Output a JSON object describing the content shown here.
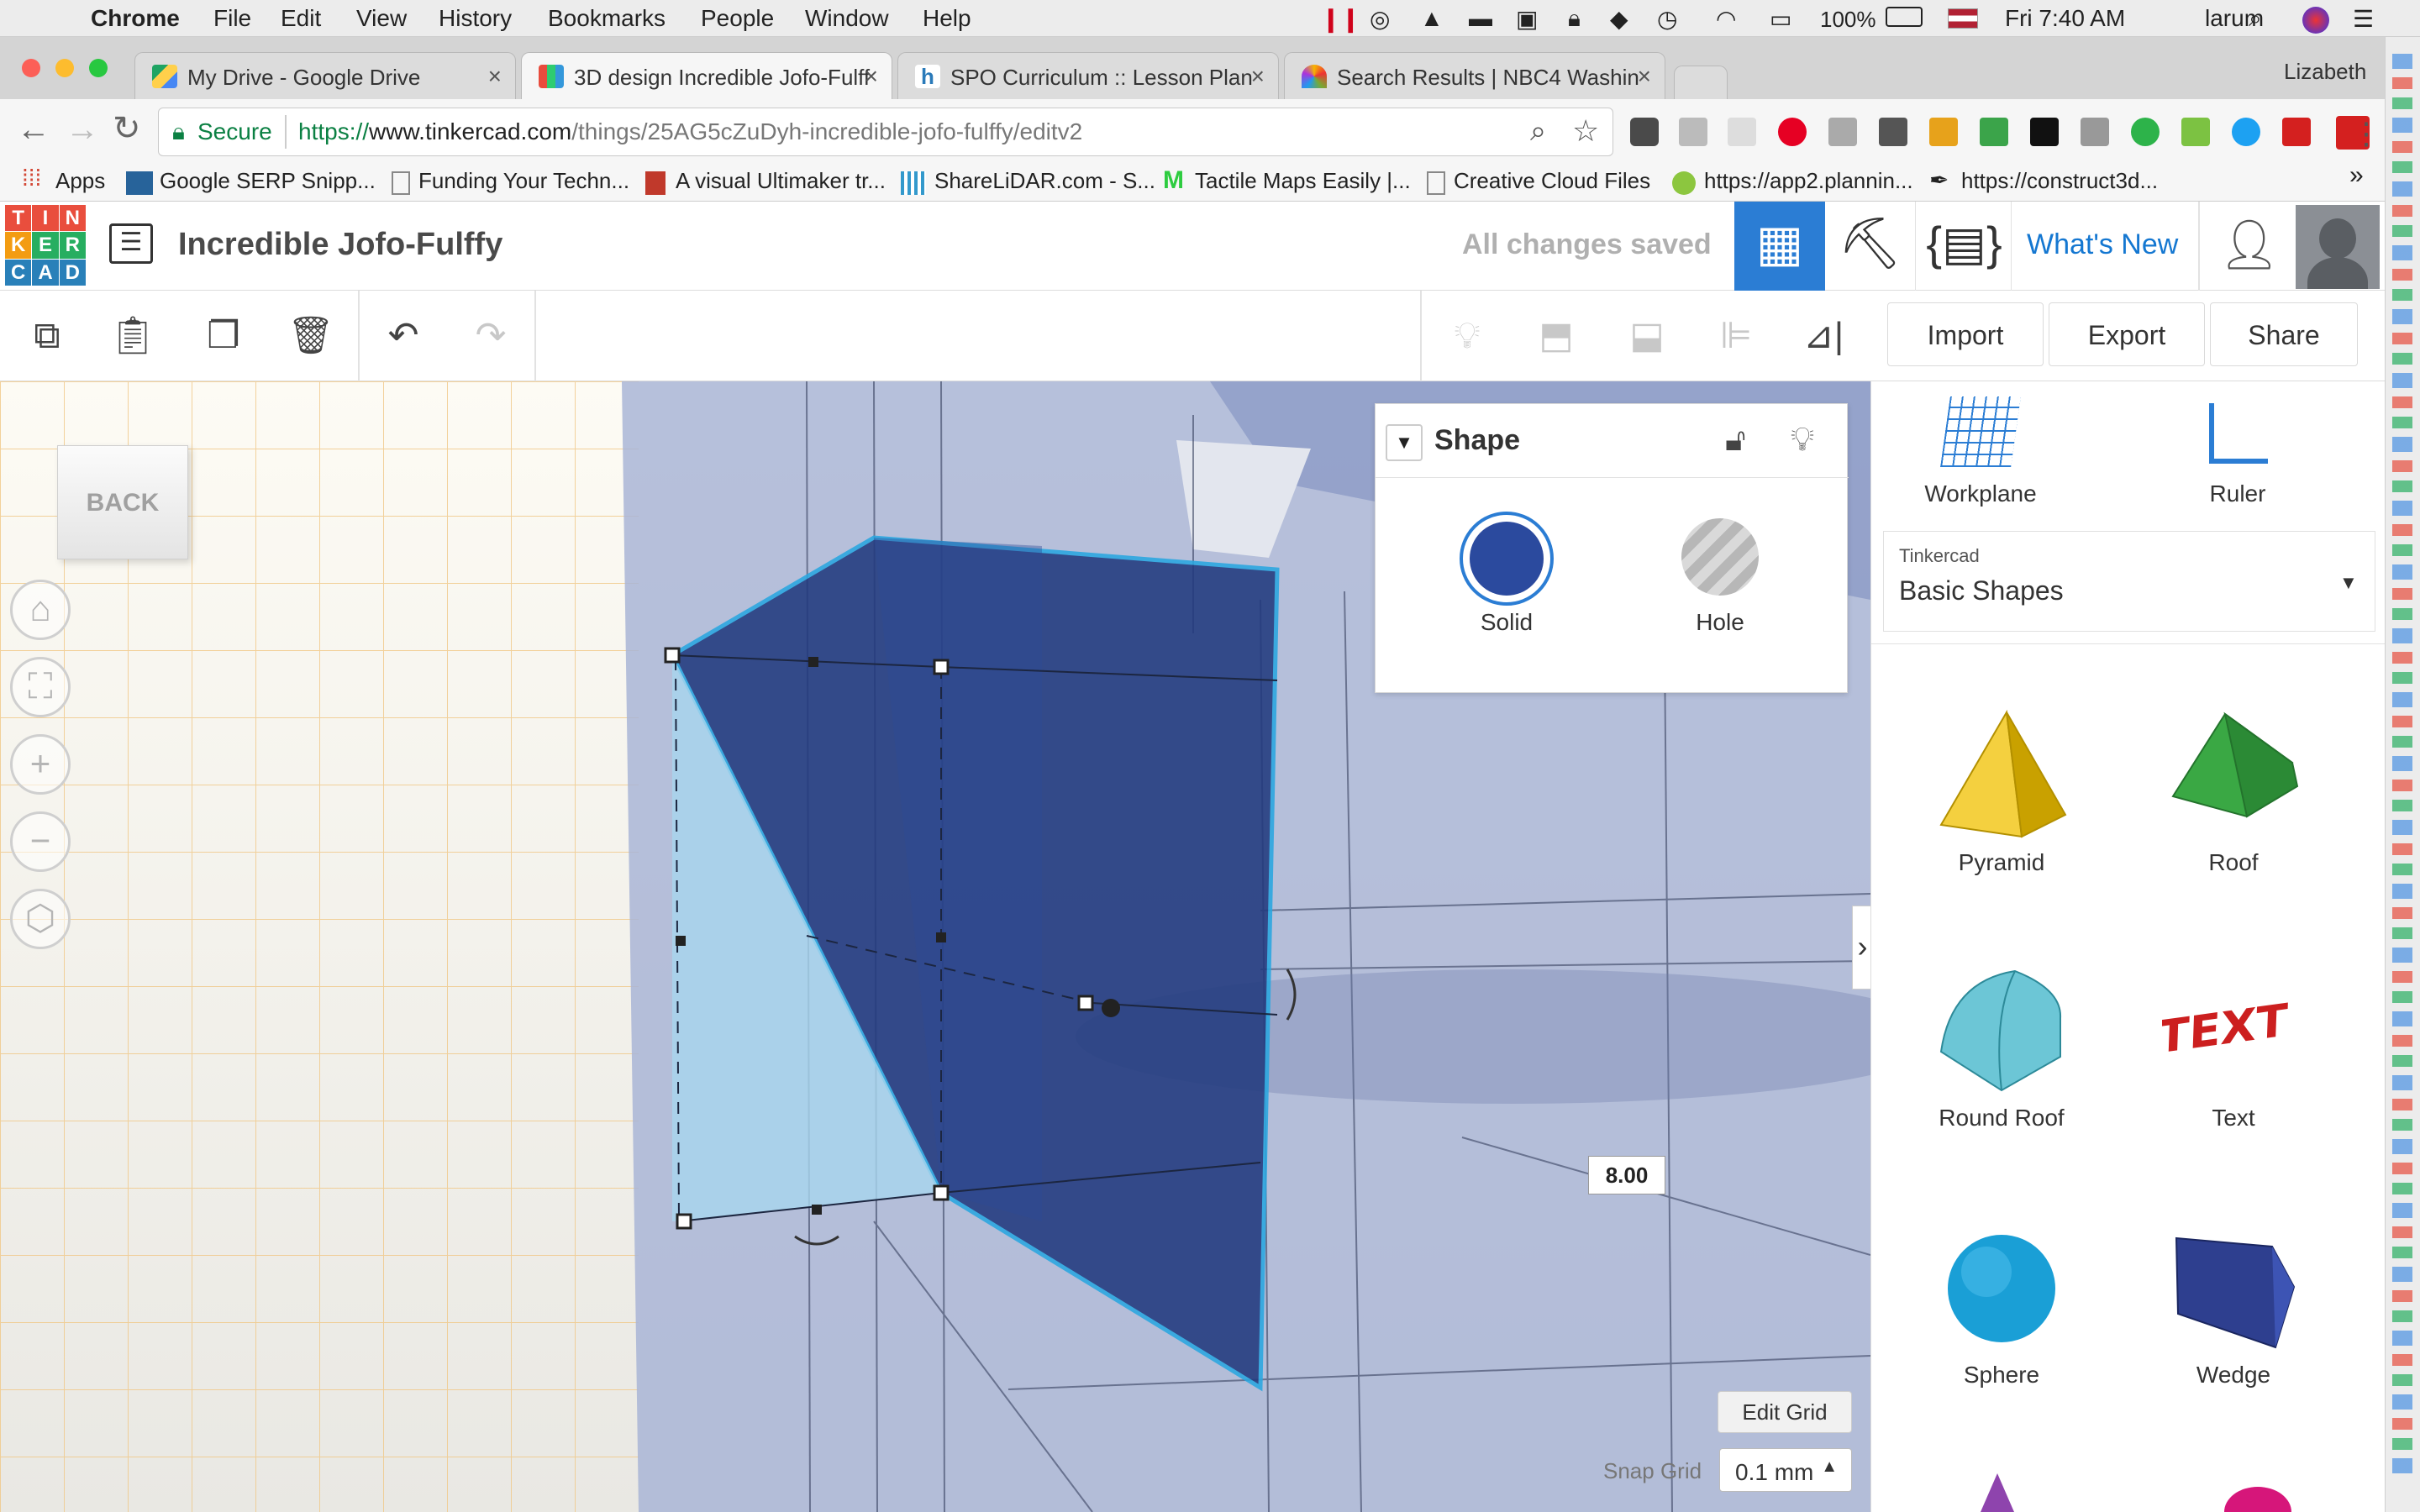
{
  "menubar": {
    "app": "Chrome",
    "items": [
      "File",
      "Edit",
      "View",
      "History",
      "Bookmarks",
      "People",
      "Window",
      "Help"
    ],
    "battery": "100%",
    "clock": "Fri 7:40 AM",
    "user": "larum"
  },
  "tabs": [
    {
      "title": "My Drive - Google Drive"
    },
    {
      "title": "3D design Incredible Jofo-Fulff"
    },
    {
      "title": "SPO Curriculum :: Lesson Plan"
    },
    {
      "title": "Search Results | NBC4 Washin"
    }
  ],
  "profile_name": "Lizabeth",
  "address": {
    "secure_label": "Secure",
    "url_prefix": "https://",
    "url_domain": "www.tinkercad.com",
    "url_path": "/things/25AG5cZuDyh-incredible-jofo-fulffy/editv2"
  },
  "bookmarks": [
    "Apps",
    "Google SERP Snipp...",
    "Funding Your Techn...",
    "A visual Ultimaker tr...",
    "ShareLiDAR.com - S...",
    "Tactile Maps Easily |...",
    "Creative Cloud Files",
    "https://app2.plannin...",
    "https://construct3d..."
  ],
  "tinkercad": {
    "logo_letters": [
      "T",
      "I",
      "N",
      "K",
      "E",
      "R",
      "C",
      "A",
      "D"
    ],
    "design_title": "Incredible Jofo-Fulffy",
    "save_status": "All changes saved",
    "whats_new": "What's New",
    "import": "Import",
    "export": "Export",
    "share": "Share"
  },
  "viewcube_label": "BACK",
  "shape_panel": {
    "title": "Shape",
    "solid": "Solid",
    "hole": "Hole"
  },
  "dimension_value": "8.00",
  "edit_grid": "Edit Grid",
  "snap_grid": {
    "label": "Snap Grid",
    "value": "0.1 mm"
  },
  "right_panel": {
    "workplane": "Workplane",
    "ruler": "Ruler",
    "library_source": "Tinkercad",
    "library_name": "Basic Shapes",
    "shapes": [
      {
        "name": "Pyramid",
        "icon": "pyramid-icon",
        "color": "#f0c419"
      },
      {
        "name": "Roof",
        "icon": "roof-icon",
        "color": "#3aa844"
      },
      {
        "name": "Round Roof",
        "icon": "round-roof-icon",
        "color": "#6cc6d6"
      },
      {
        "name": "Text",
        "icon": "text-shape-icon",
        "color": "#cc1f1f"
      },
      {
        "name": "Sphere",
        "icon": "sphere-icon",
        "color": "#1a9fd6"
      },
      {
        "name": "Wedge",
        "icon": "wedge-icon",
        "color": "#2e3f8f"
      }
    ]
  },
  "colors": {
    "accent": "#1477d1",
    "tab_active_grid": "#2b7dd4",
    "solid": "#2b4a9e"
  }
}
